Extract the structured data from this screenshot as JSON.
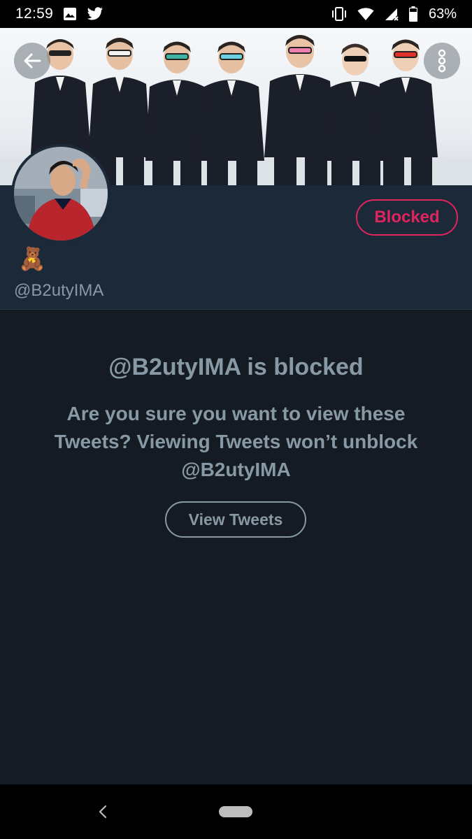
{
  "status_bar": {
    "time": "12:59",
    "left_icons": [
      "image-icon",
      "twitter-bird-icon"
    ],
    "right_icons": [
      "vibrate-icon",
      "wifi-icon",
      "cell-signal-icon",
      "battery-icon"
    ],
    "battery_percent": "63%"
  },
  "header": {
    "back_icon": "arrow-left-icon",
    "more_icon": "more-vertical-icon"
  },
  "profile": {
    "display_name": "🧸",
    "handle": "@B2utyIMA",
    "blocked_button_label": "Blocked",
    "blocked_color": "#e0245e"
  },
  "notice": {
    "title": "@B2utyIMA is blocked",
    "body": "Are you sure you want to view these Tweets? Viewing Tweets won’t unblock @B2utyIMA",
    "view_tweets_label": "View Tweets"
  },
  "nav_bar": {
    "back_icon": "nav-back-icon",
    "home_icon": "home-pill-icon"
  },
  "colors": {
    "background": "#141b23",
    "profile_background": "#1c2938",
    "secondary_text": "#8899a6",
    "accent_red": "#e0245e"
  }
}
